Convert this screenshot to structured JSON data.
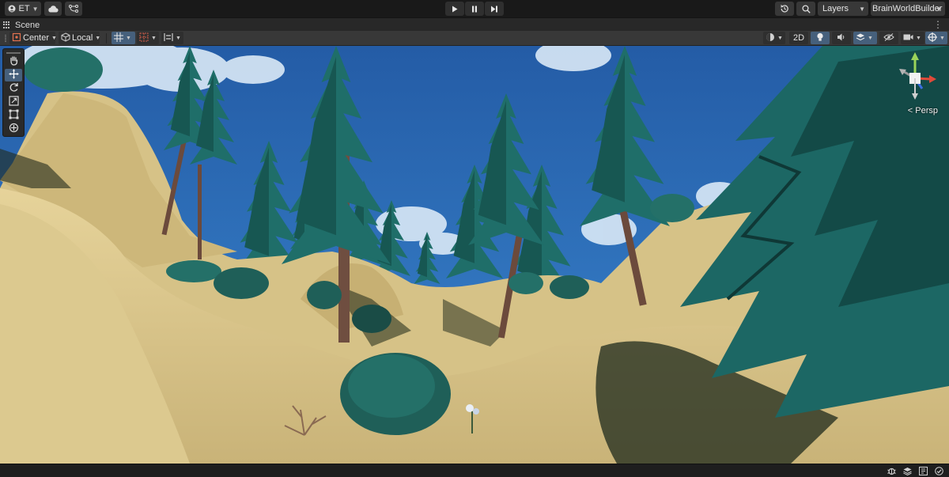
{
  "toolbar": {
    "account_label": "ET",
    "layers_label": "Layers",
    "layout_label": "BrainWorldBuilder"
  },
  "scene_tab": {
    "title": "Scene"
  },
  "scene_toolbar": {
    "pivot_mode": "Center",
    "pivot_rotation": "Local",
    "mode_2d": "2D"
  },
  "viewport": {
    "camera_mode": "< Persp",
    "active_tool": "move"
  },
  "colors": {
    "accent": "#46607c",
    "sky": "#2a6ab4",
    "terrain": "#d9c48a",
    "foliage": "#1e6e6a"
  },
  "icons": {
    "tools": [
      "hand-icon",
      "move-icon",
      "rotate-icon",
      "scale-icon",
      "rect-icon",
      "transform-icon"
    ],
    "status": [
      "debug-icon",
      "stack-icon",
      "network-icon",
      "check-icon"
    ]
  }
}
